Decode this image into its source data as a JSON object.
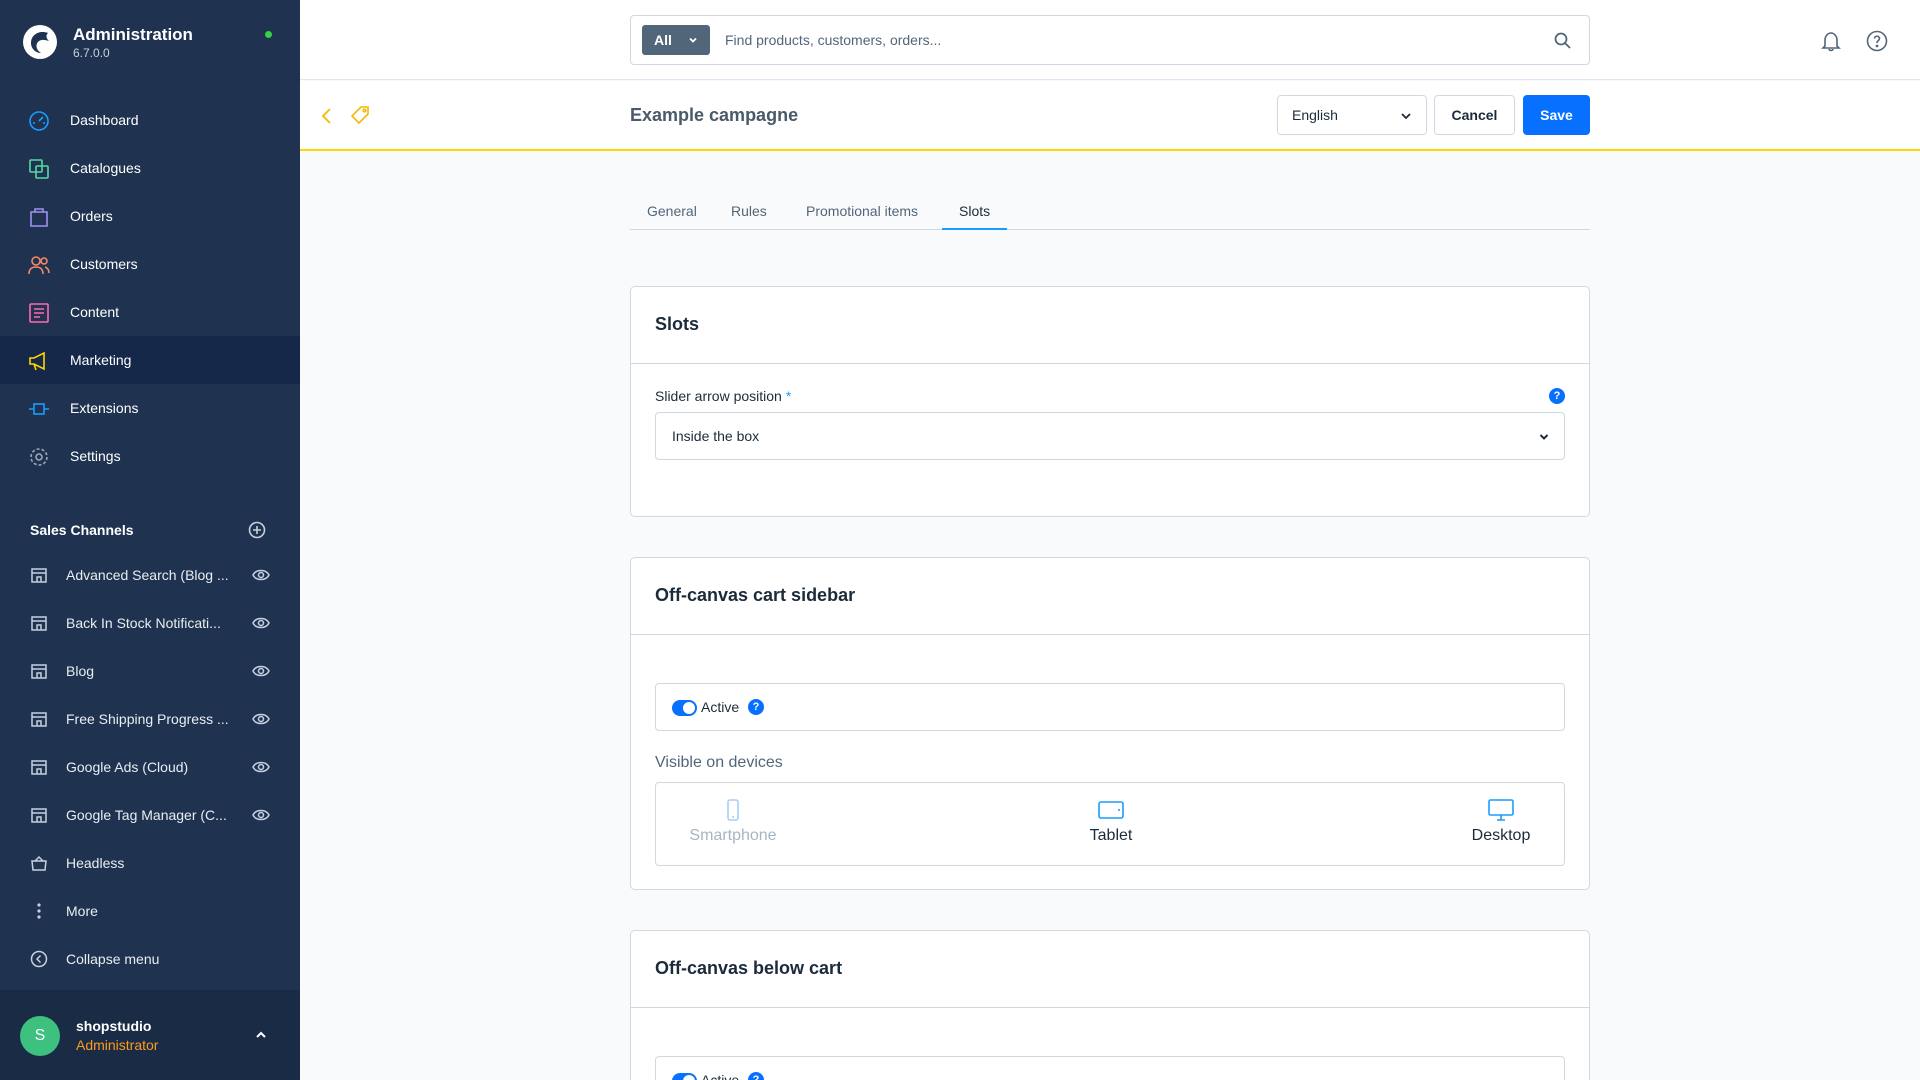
{
  "app": {
    "title": "Administration",
    "version": "6.7.0.0"
  },
  "nav": {
    "items": [
      {
        "label": "Dashboard",
        "icon": "dashboard-icon",
        "color": "#189eff"
      },
      {
        "label": "Catalogues",
        "icon": "catalogue-icon",
        "color": "#57d9a3"
      },
      {
        "label": "Orders",
        "icon": "orders-icon",
        "color": "#a092f0"
      },
      {
        "label": "Customers",
        "icon": "customers-icon",
        "color": "#f88962"
      },
      {
        "label": "Content",
        "icon": "content-icon",
        "color": "#ff68b4"
      },
      {
        "label": "Marketing",
        "icon": "marketing-icon",
        "color": "#ffd700",
        "active": true
      },
      {
        "label": "Extensions",
        "icon": "extensions-icon",
        "color": "#189eff"
      },
      {
        "label": "Settings",
        "icon": "settings-icon",
        "color": "#9aa8b5"
      }
    ]
  },
  "sales_channels": {
    "title": "Sales Channels",
    "items": [
      {
        "label": "Advanced Search (Blog ..."
      },
      {
        "label": "Back In Stock Notificati..."
      },
      {
        "label": "Blog"
      },
      {
        "label": "Free Shipping Progress ..."
      },
      {
        "label": "Google Ads (Cloud)"
      },
      {
        "label": "Google Tag Manager (C..."
      },
      {
        "label": "Headless"
      }
    ],
    "more_label": "More",
    "collapse_label": "Collapse menu"
  },
  "user": {
    "initial": "S",
    "name": "shopstudio",
    "role": "Administrator"
  },
  "search": {
    "type_label": "All",
    "placeholder": "Find products, customers, orders..."
  },
  "smartbar": {
    "title": "Example campagne",
    "language": "English",
    "cancel_label": "Cancel",
    "save_label": "Save"
  },
  "tabs": [
    {
      "label": "General"
    },
    {
      "label": "Rules"
    },
    {
      "label": "Promotional items"
    },
    {
      "label": "Slots",
      "active": true
    }
  ],
  "cards": {
    "slots": {
      "title": "Slots",
      "field_label": "Slider arrow position",
      "required_mark": "*",
      "info": "?",
      "value": "Inside the box"
    },
    "offcanvas_sidebar": {
      "title": "Off-canvas cart sidebar",
      "active_label": "Active",
      "info": "?",
      "devices_label": "Visible on devices",
      "devices": [
        {
          "label": "Smartphone",
          "enabled": false
        },
        {
          "label": "Tablet",
          "enabled": true
        },
        {
          "label": "Desktop",
          "enabled": true
        }
      ]
    },
    "offcanvas_below": {
      "title": "Off-canvas below cart",
      "active_label": "Active",
      "info": "?"
    }
  },
  "colors": {
    "accent": "#0870ff",
    "sidebar": "#1f3350",
    "highlight": "#ffd700",
    "status_online": "#37d046"
  }
}
